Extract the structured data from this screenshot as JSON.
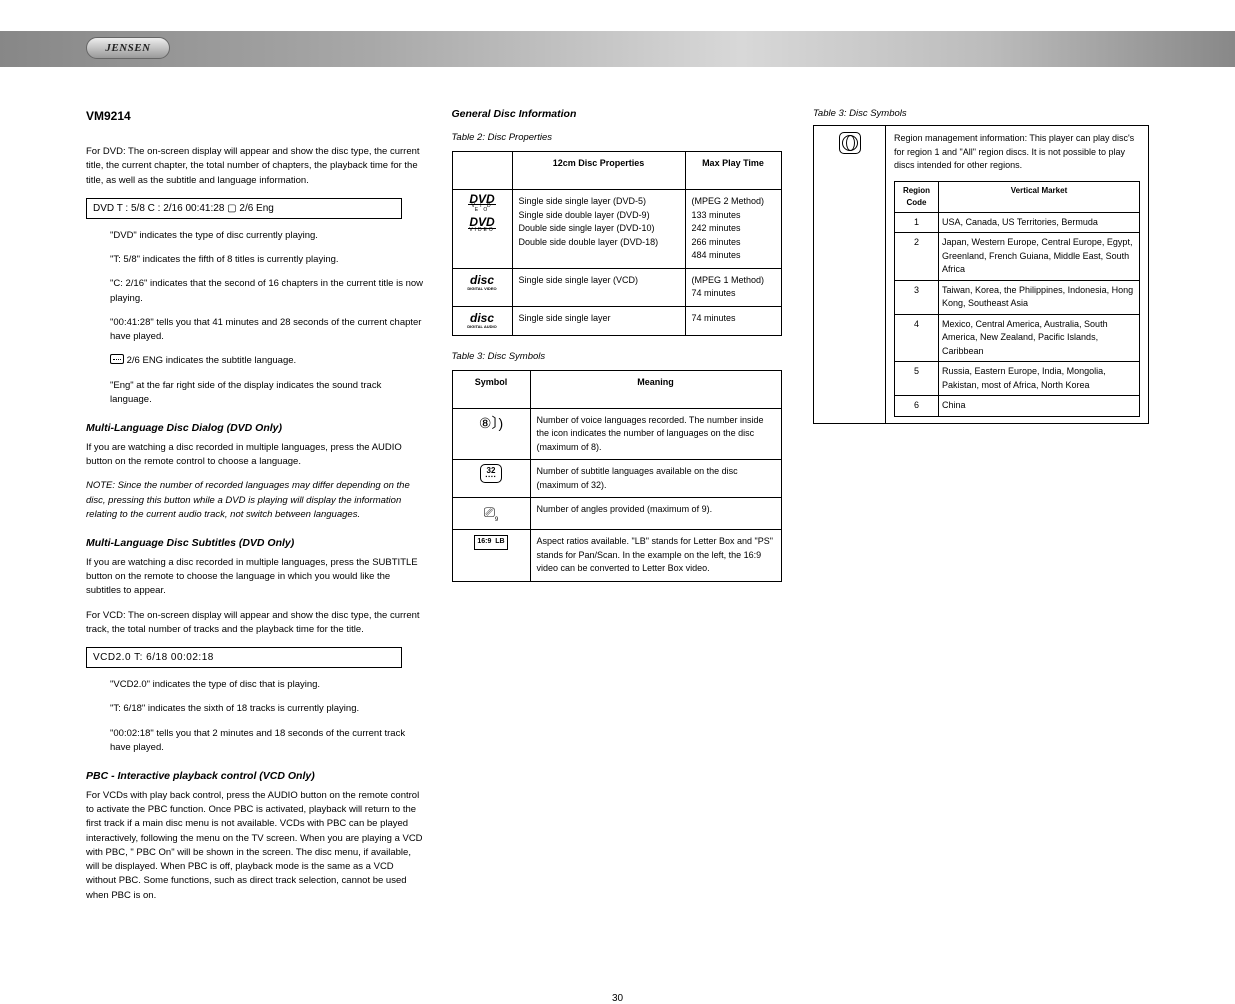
{
  "header": {
    "brand": "JENSEN"
  },
  "model": "VM9214",
  "col1": {
    "intro": "For DVD: The on-screen display will appear and show the disc type, the current title, the current chapter, the total number of chapters, the playback time for the title, as well as the subtitle and language information.",
    "dvd_display": "DVD   T : 5/8   C : 2/16    00:41:28  ▢ 2/6   Eng",
    "dvd_legend": [
      "\"DVD\" indicates the type of disc currently playing.",
      "\"T: 5/8\" indicates the fifth of 8 titles is currently playing.",
      "\"C: 2/16\" indicates that the second of 16 chapters in the current title is now playing.",
      "\"00:41:28\" tells you that 41 minutes and 28 seconds of the current chapter have played.",
      "        2/6 ENG indicates the subtitle language.",
      "\"Eng\" at the far right side of the display indicates the sound track language."
    ],
    "multilang_title": "Multi-Language Disc Dialog (DVD Only)",
    "multilang_text": "If you are watching a disc recorded in multiple languages, press the AUDIO button on the remote control to choose a language.",
    "note_label": "NOTE:",
    "note1": "Since the number of recorded languages may differ depending on the disc, pressing this button while a DVD is playing will display the information relating to the current audio track, not switch between languages.",
    "subcap_title": "Multi-Language Disc Subtitles (DVD Only)",
    "subcap_text": "If you are watching a disc recorded in multiple languages, press the SUBTITLE button on the remote to choose the language in which you would like the subtitles to appear.",
    "vcd_intro": "For VCD: The on-screen display will appear and show the disc type, the current track, the total number of tracks and the playback time for the title.",
    "vcd_display": "VCD2.0         T:  6/18           00:02:18",
    "vcd_legend": [
      "\"VCD2.0\" indicates the type of disc that is playing.",
      "\"T: 6/18\" indicates the sixth of 18 tracks is currently playing.",
      "\"00:02:18\" tells you that 2 minutes and 18 seconds of the current track have played."
    ],
    "pbc_title": "PBC - Interactive playback control (VCD Only)",
    "pbc_text": "For VCDs with play back control, press the AUDIO button on the remote control to activate the PBC function. Once PBC is activated, playback will return to the first track if a main disc menu is not available. VCDs with PBC can be played interactively, following the menu on the TV screen. When you are playing a VCD with PBC,  \" PBC On\"  will be shown in the screen. The disc menu, if available, will be displayed. When PBC is off, playback mode is the same as a VCD without PBC. Some functions, such as direct track selection, cannot be used when PBC is on."
  },
  "col2": {
    "gen_title": "General Disc Information",
    "th": {
      "a": "Table 2: Disc Properties",
      "b": "12cm Disc Properties",
      "c": "Max Play Time"
    },
    "rows": [
      {
        "icon1": "dvd",
        "icon2": "dvd",
        "b": "Single side single layer (DVD-5)\nSingle side double layer (DVD-9)\nDouble side single layer (DVD-10)\nDouble side double layer (DVD-18)",
        "c": "(MPEG 2 Method)\n133 minutes\n242 minutes\n266 minutes\n484 minutes"
      },
      {
        "icon1": "vcd",
        "b": "Single side single layer (VCD)",
        "c": "(MPEG 1 Method)\n74 minutes"
      },
      {
        "icon1": "cd",
        "b": "Single side single layer",
        "c": "74 minutes"
      }
    ],
    "symh": "Table 3: Disc Symbols",
    "sym_cols": {
      "a": "Symbol",
      "b": "Meaning"
    },
    "syms": [
      {
        "icon": "speaker",
        "text": "Number of voice languages recorded. The number inside the icon indicates the number of languages on the disc (maximum of 8)."
      },
      {
        "icon": "32",
        "text": "Number of subtitle languages available on the disc (maximum of 32)."
      },
      {
        "icon": "angle",
        "text": "Number of angles provided (maximum of 9)."
      },
      {
        "icon": "169",
        "text": "Aspect ratios available. \"LB\" stands for Letter Box and \"PS\" stands for Pan/Scan. In the example on the left, the 16:9 video can be converted to Letter Box video."
      }
    ]
  },
  "col3": {
    "t3": "Table 3: Disc Symbols",
    "reg_meaning": "Region management information: This player can play disc's for region 1 and \"All\" region discs. It is not possible to play discs intended for other regions.",
    "code_h": "Region Code",
    "area_h": "Vertical Market",
    "regions": [
      {
        "c": "1",
        "a": "USA, Canada, US Territories, Bermuda"
      },
      {
        "c": "2",
        "a": "Japan, Western Europe, Central Europe, Egypt, Greenland, French Guiana, Middle East, South Africa"
      },
      {
        "c": "3",
        "a": "Taiwan, Korea, the Philippines, Indonesia, Hong Kong, Southeast Asia"
      },
      {
        "c": "4",
        "a": "Mexico, Central America, Australia, South America, New Zealand, Pacific Islands, Caribbean"
      },
      {
        "c": "5",
        "a": "Russia, Eastern Europe, India, Mongolia, Pakistan, most of Africa, North Korea"
      },
      {
        "c": "6",
        "a": "China"
      }
    ]
  },
  "footer": "30"
}
